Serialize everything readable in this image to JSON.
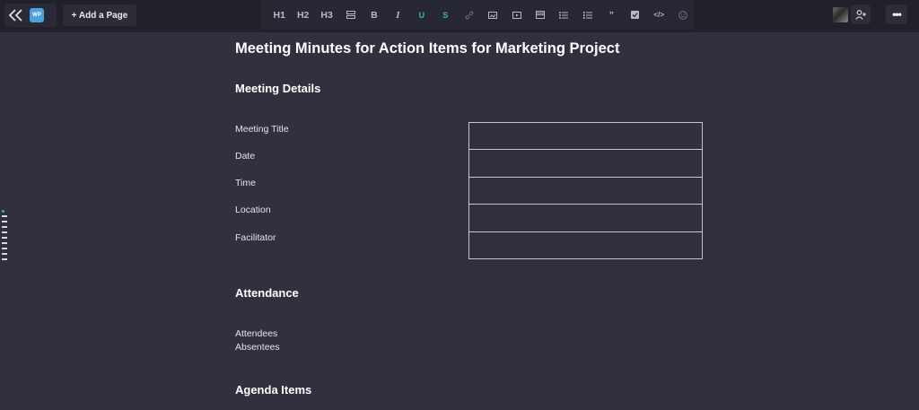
{
  "header": {
    "logo_text": "WP",
    "add_page_label": "+ Add a Page",
    "more_label": "•••"
  },
  "toolbar": {
    "tools": [
      {
        "name": "heading1-tool",
        "label": "H1"
      },
      {
        "name": "heading2-tool",
        "label": "H2"
      },
      {
        "name": "heading3-tool",
        "label": "H3"
      },
      {
        "name": "divider-tool",
        "label": ""
      },
      {
        "name": "bold-tool",
        "label": "B"
      },
      {
        "name": "italic-tool",
        "label": "I"
      },
      {
        "name": "underline-tool",
        "label": "U"
      },
      {
        "name": "strikethrough-tool",
        "label": "S"
      },
      {
        "name": "link-tool",
        "label": ""
      },
      {
        "name": "image-tool",
        "label": ""
      },
      {
        "name": "video-tool",
        "label": ""
      },
      {
        "name": "table-tool",
        "label": ""
      },
      {
        "name": "bullet-list-tool",
        "label": ""
      },
      {
        "name": "numbered-list-tool",
        "label": ""
      },
      {
        "name": "quote-tool",
        "label": "”"
      },
      {
        "name": "checklist-tool",
        "label": ""
      },
      {
        "name": "code-tool",
        "label": "</>"
      },
      {
        "name": "emoji-tool",
        "label": ""
      }
    ]
  },
  "document": {
    "title": "Meeting Minutes for Action Items for Marketing Project",
    "meeting_details": {
      "heading": "Meeting Details",
      "fields": [
        {
          "label": "Meeting Title",
          "value": ""
        },
        {
          "label": "Date",
          "value": ""
        },
        {
          "label": "Time",
          "value": ""
        },
        {
          "label": "Location",
          "value": ""
        },
        {
          "label": "Facilitator",
          "value": ""
        }
      ]
    },
    "attendance": {
      "heading": "Attendance",
      "lines": [
        "Attendees",
        "Absentees"
      ]
    },
    "agenda": {
      "heading": "Agenda Items"
    }
  },
  "colors": {
    "background": "#30303f",
    "topbar": "#21212c",
    "accent": "#3ab89a",
    "logo": "#4aa3df"
  }
}
